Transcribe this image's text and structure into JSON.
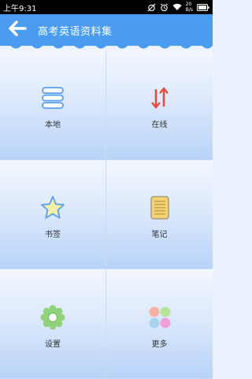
{
  "status": {
    "time": "上午9:31",
    "net_speed_value": "20",
    "net_speed_unit": "B/s"
  },
  "app_bar": {
    "title": "高考英语资料集"
  },
  "grid": [
    {
      "label": "本地",
      "icon": "list-icon"
    },
    {
      "label": "在线",
      "icon": "transfer-arrows-icon"
    },
    {
      "label": "书签",
      "icon": "star-icon"
    },
    {
      "label": "笔记",
      "icon": "notepad-icon"
    },
    {
      "label": "设置",
      "icon": "gear-icon"
    },
    {
      "label": "更多",
      "icon": "four-dots-icon"
    }
  ],
  "colors": {
    "app_bar": "#4a9cf0",
    "status_bar": "#000000",
    "icon_blue": "#5aa0ee",
    "icon_red": "#e84b3a",
    "star": "#f5f0a8",
    "notepad": "#f3d372",
    "gear": "#8fd27a"
  }
}
